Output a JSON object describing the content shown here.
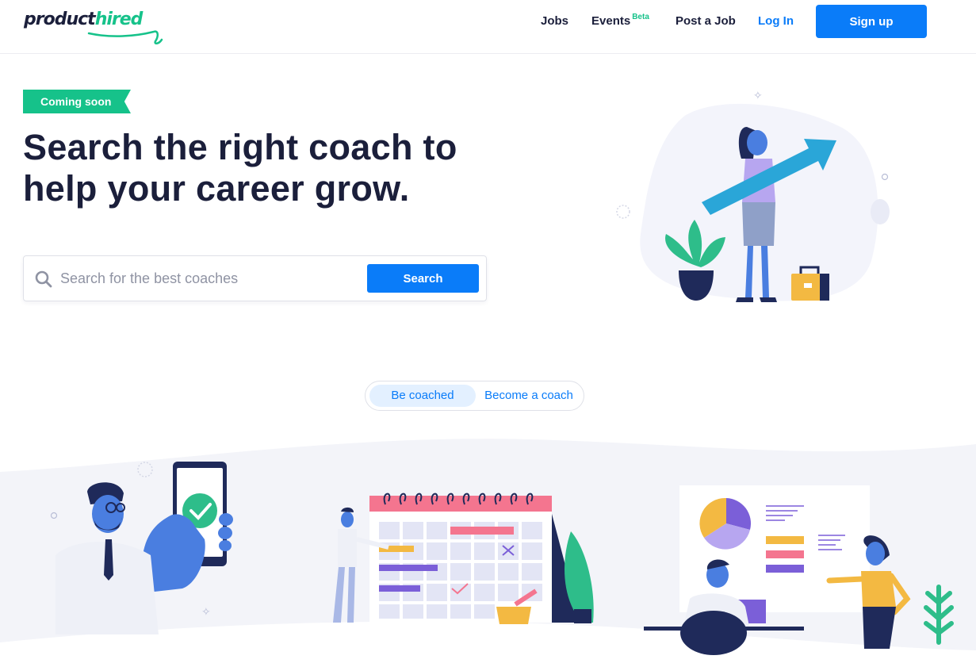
{
  "brand": {
    "logo_product": "product",
    "logo_hired": "hired",
    "primary_color": "#0a7cf9",
    "accent_color": "#16c28a",
    "text_color": "#1b1f3b"
  },
  "nav": {
    "jobs": "Jobs",
    "events": "Events",
    "events_badge": "Beta",
    "post_job": "Post a Job",
    "login": "Log In",
    "signup": "Sign up"
  },
  "hero": {
    "badge": "Coming soon",
    "title_line1": "Search the right coach to",
    "title_line2": "help your career grow.",
    "search_placeholder": "Search for the best coaches",
    "search_value": "",
    "search_button": "Search",
    "illustration_icon": "woman-with-growth-arrow-illustration"
  },
  "toggle": {
    "options": [
      {
        "label": "Be coached",
        "selected": true
      },
      {
        "label": "Become a coach",
        "selected": false
      }
    ]
  },
  "illustrations": {
    "left": "coach-with-phone-checkmark-illustration",
    "middle": "calendar-schedule-illustration",
    "right": "presentation-whiteboard-illustration"
  }
}
